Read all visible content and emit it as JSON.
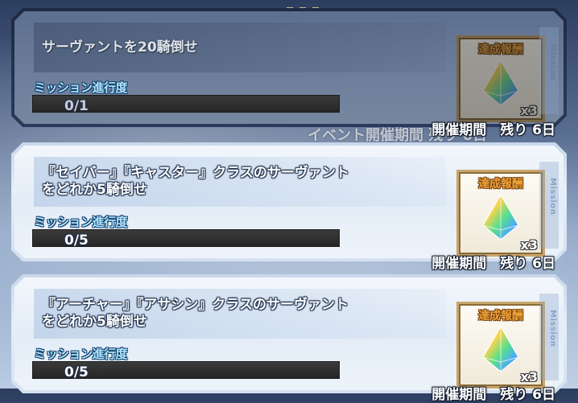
{
  "missions": [
    {
      "description": "サーヴァントを20騎倒せ",
      "progress_label": "ミッション進行度",
      "progress": "0/1",
      "progress_fraction": 0,
      "reward_label": "達成報酬",
      "reward_qty": "x3",
      "side_label": "Mission",
      "period": "開催期間　残り 6日",
      "state": "inactive"
    },
    {
      "description": "『セイバー』『キャスター』クラスのサーヴァント\nをどれか5騎倒せ",
      "progress_label": "ミッション進行度",
      "progress": "0/5",
      "progress_fraction": 0,
      "reward_label": "達成報酬",
      "reward_qty": "x3",
      "side_label": "Mission",
      "period": "開催期間　残り 6日",
      "state": "active"
    },
    {
      "description": "『アーチャー』『アサシン』クラスのサーヴァント\nをどれか5騎倒せ",
      "progress_label": "ミッション進行度",
      "progress": "0/5",
      "progress_fraction": 0,
      "reward_label": "達成報酬",
      "reward_qty": "x3",
      "side_label": "Mission",
      "period": "開催期間　残り 6日",
      "state": "active"
    }
  ],
  "background_text": "イベント開催期間 残り 6日",
  "colors": {
    "progress_label": "#aee6ff",
    "reward_label": "#f0a238",
    "reward_border": "#c9a66b"
  },
  "icons": {
    "reward": "rainbow-crystal-icon"
  }
}
